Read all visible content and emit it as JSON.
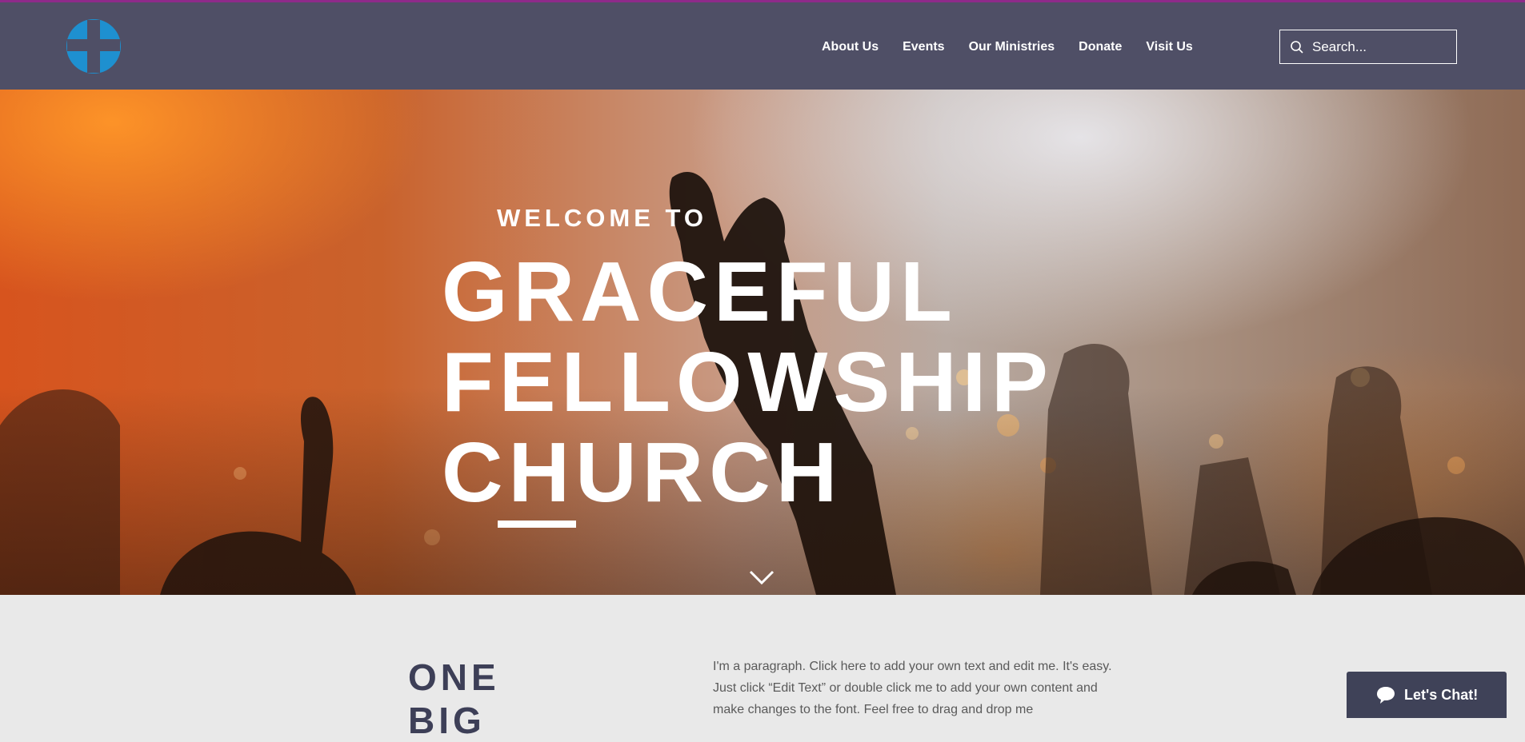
{
  "header": {
    "logo_name": "cross-logo",
    "nav": [
      "About Us",
      "Events",
      "Our Ministries",
      "Donate",
      "Visit Us"
    ],
    "search_placeholder": "Search..."
  },
  "hero": {
    "kicker": "WELCOME TO",
    "title_lines": [
      "GRACEFUL",
      "FELLOWSHIP",
      "CHURCH"
    ]
  },
  "section": {
    "heading_lines": [
      "ONE",
      "BIG"
    ],
    "paragraph": "I'm a paragraph. Click here to add your own text and edit me. It's easy. Just click “Edit Text” or double click me to add your own content and make changes to the font. Feel free to drag and drop me"
  },
  "chat": {
    "label": "Let's Chat!"
  },
  "colors": {
    "header_bg": "#4f4f66",
    "accent_blue": "#1e90d0",
    "heading_dark": "#3d3f57",
    "section_bg": "#e9e9e9"
  }
}
